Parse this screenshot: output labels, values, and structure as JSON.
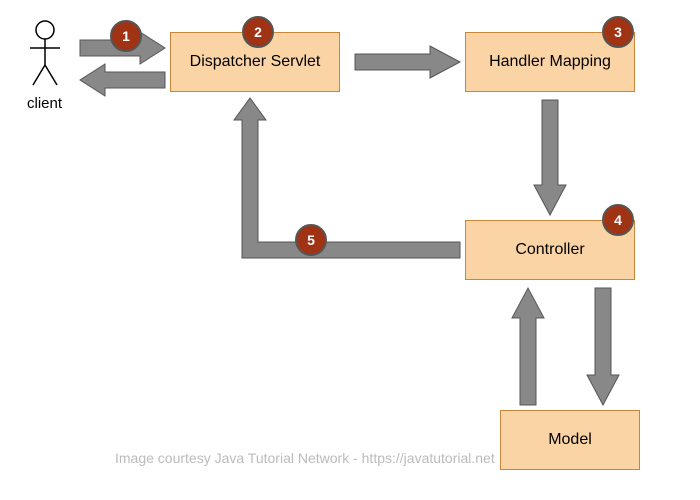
{
  "nodes": {
    "client_label": "client",
    "dispatcher": "Dispatcher Servlet",
    "handler": "Handler Mapping",
    "controller": "Controller",
    "model": "Model"
  },
  "badges": {
    "b1": "1",
    "b2": "2",
    "b3": "3",
    "b4": "4",
    "b5": "5"
  },
  "credit": "Image courtesy Java Tutorial Network - https://javatutorial.net",
  "colors": {
    "box_fill": "#FBD4A6",
    "box_border": "#C98639",
    "arrow": "#888888",
    "badge": "#A03314"
  }
}
